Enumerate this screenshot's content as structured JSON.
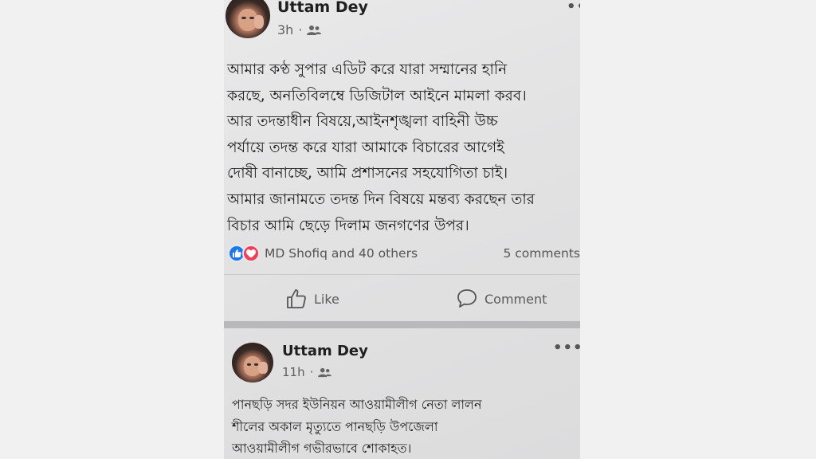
{
  "post1": {
    "author": "Uttam Dey",
    "time": "3h",
    "audience_icon": "friends-icon",
    "more_label": "••",
    "body": "আমার কণ্ঠ সুপার এডিট করে যারা সম্মানের হানি\nকরছে, অনতিবিলম্বে ডিজিটাল আইনে মামলা করব।\nআর তদন্তাধীন বিষয়ে,আইনশৃঙ্খলা বাহিনী উচ্চ\nপর্যায়ে তদন্ত করে যারা আমাকে বিচারের আগেই\nদোষী বানাচ্ছে, আমি প্রশাসনের সহযোগিতা চাই।\nআমার জানামতে তদন্ত দিন বিষয়ে মন্তব্য করছেন তার\nবিচার আমি ছেড়ে দিলাম জনগণের উপর।",
    "reactions": {
      "icons": [
        "like-reaction-icon",
        "love-reaction-icon"
      ],
      "names": "MD Shofiq and 40 others",
      "comments": "5 comments"
    },
    "actions": {
      "like": "Like",
      "comment": "Comment"
    }
  },
  "post2": {
    "author": "Uttam Dey",
    "time": "11h",
    "audience_icon": "friends-icon",
    "more_label": "•••",
    "body": "পানছড়ি সদর ইউনিয়ন আওয়ামীলীগ নেতা লালন\nশীলের অকাল মৃত্যুতে পানছড়ি উপজেলা\nআওয়ামীলীগ গভীরভাবে  শোকাহত।"
  },
  "colors": {
    "like_blue": "#1877f2",
    "love_red": "#f33e58",
    "screen_bg": "#e4e4e5",
    "separator": "#b9b9bb"
  }
}
